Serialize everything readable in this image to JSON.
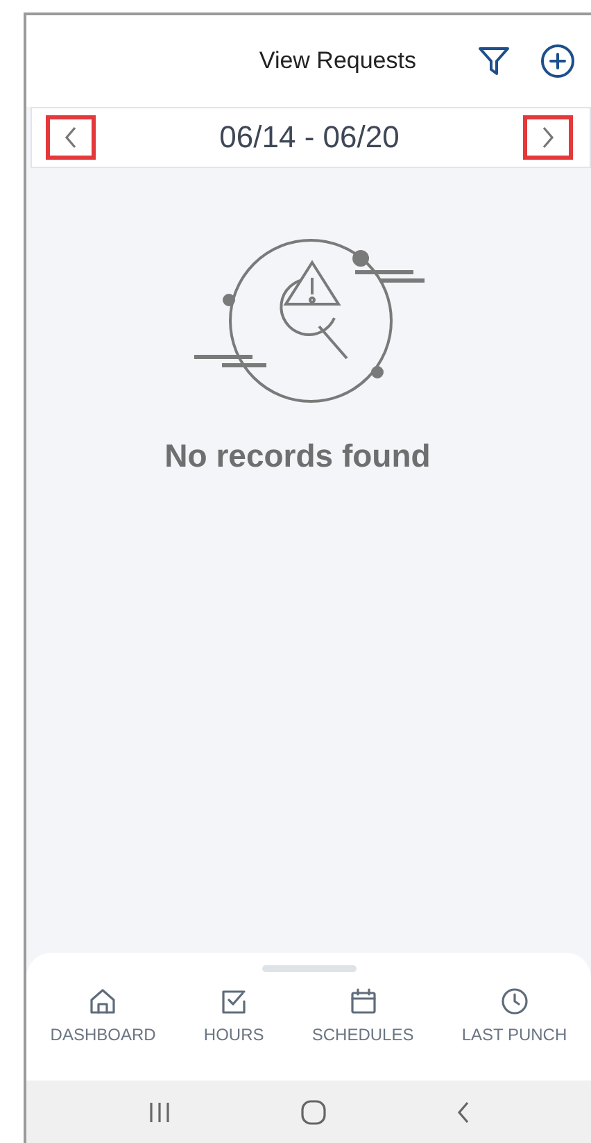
{
  "header": {
    "title": "View Requests"
  },
  "date_range": {
    "label": "06/14 - 06/20"
  },
  "empty_state": {
    "message": "No records found"
  },
  "bottom_nav": [
    {
      "label": "DASHBOARD"
    },
    {
      "label": "HOURS"
    },
    {
      "label": "SCHEDULES"
    },
    {
      "label": "LAST PUNCH"
    }
  ]
}
